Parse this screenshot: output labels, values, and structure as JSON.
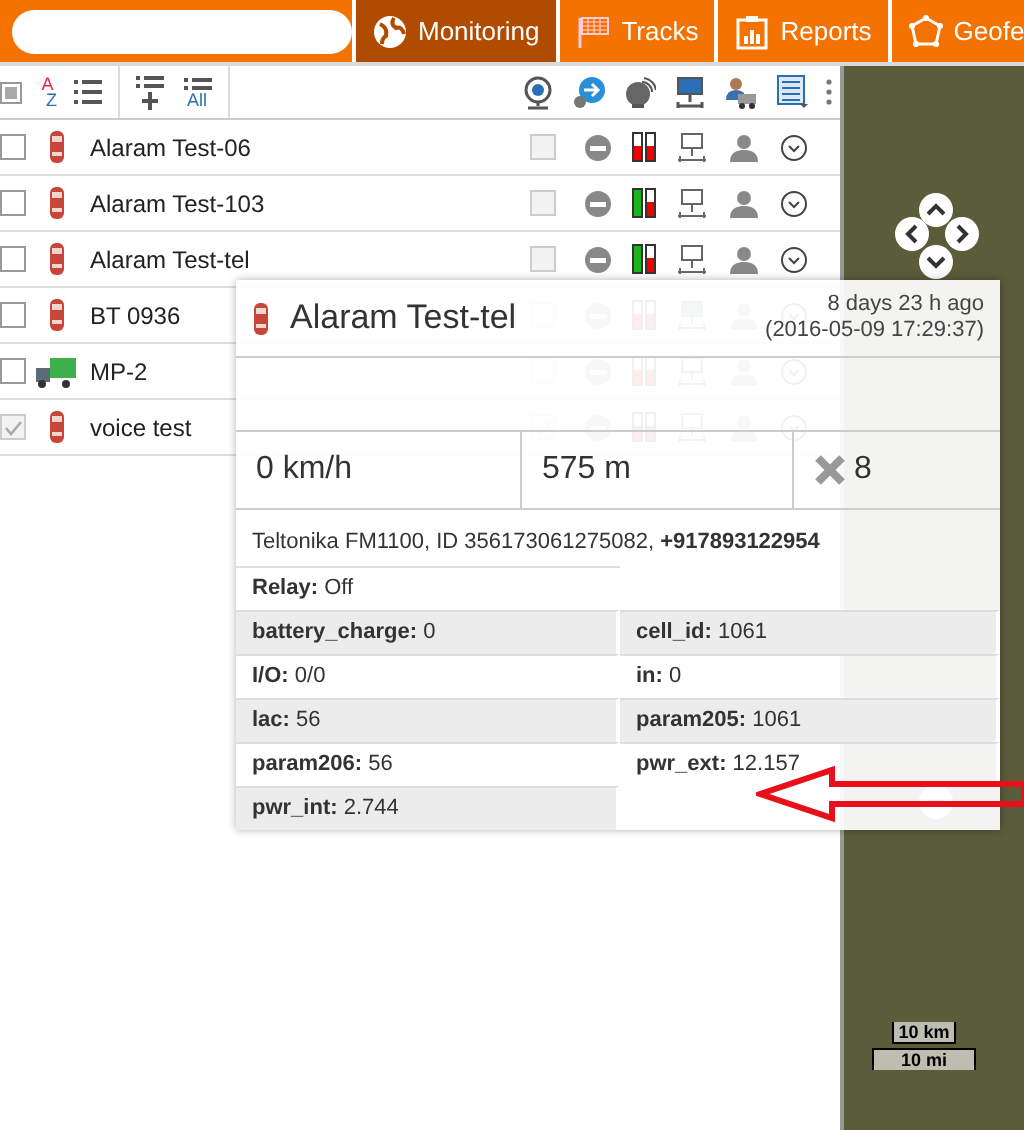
{
  "nav": {
    "tabs": [
      {
        "label": "Monitoring",
        "selected": true
      },
      {
        "label": "Tracks",
        "selected": false
      },
      {
        "label": "Reports",
        "selected": false
      },
      {
        "label": "Geofe",
        "selected": false
      }
    ]
  },
  "toolbar": {
    "sort_top": "A",
    "sort_bottom": "Z",
    "all_label": "All"
  },
  "objects": [
    {
      "name": "Alaram Test-06",
      "kind": "car",
      "checked": false,
      "gps": false,
      "online": false
    },
    {
      "name": "Alaram Test-103",
      "kind": "car",
      "checked": false,
      "gps": true,
      "online": false
    },
    {
      "name": "Alaram Test-tel",
      "kind": "car",
      "checked": false,
      "gps": true,
      "online": false
    },
    {
      "name": "BT 0936",
      "kind": "car",
      "checked": false,
      "gps": false,
      "online": true
    },
    {
      "name": "MP-2",
      "kind": "truck",
      "checked": false,
      "gps": false,
      "online": false
    },
    {
      "name": "voice test",
      "kind": "car",
      "checked": true,
      "gps": false,
      "online": false
    }
  ],
  "popup": {
    "title": "Alaram Test-tel",
    "ago": "8 days 23 h ago",
    "time": "(2016-05-09 17:29:37)",
    "speed": "0 km/h",
    "altitude": "575 m",
    "satellites": "8",
    "device": "Teltonika FM1100, ID 356173061275082, **+917893122954**",
    "relay": {
      "label": "Relay:",
      "value": "Off"
    },
    "params": [
      {
        "label": "battery_charge:",
        "value": "0"
      },
      {
        "label": "cell_id:",
        "value": "1061"
      },
      {
        "label": "I/O:",
        "value": "0/0"
      },
      {
        "label": "in:",
        "value": "0"
      },
      {
        "label": "lac:",
        "value": "56"
      },
      {
        "label": "param205:",
        "value": "1061"
      },
      {
        "label": "param206:",
        "value": "56"
      },
      {
        "label": "pwr_ext:",
        "value": "12.157"
      },
      {
        "label": "pwr_int:",
        "value": "2.744"
      }
    ]
  },
  "map": {
    "scale_km": "10 km",
    "scale_mi": "10 mi"
  }
}
